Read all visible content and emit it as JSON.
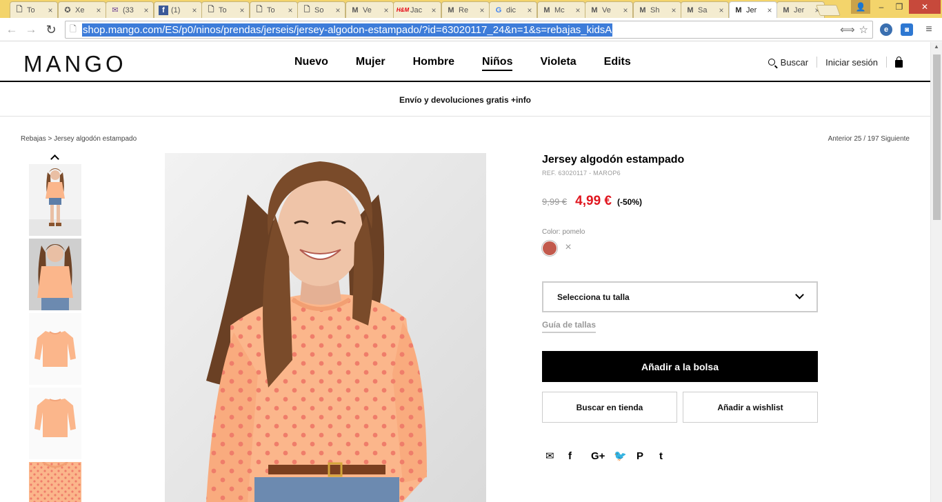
{
  "browser": {
    "tabs": [
      {
        "favicon": "document-icon",
        "glyph": "🗋",
        "title": "To"
      },
      {
        "favicon": "xe-icon",
        "glyph": "✪",
        "title": "Xe"
      },
      {
        "favicon": "mail-icon",
        "glyph": "✉",
        "title": "(33"
      },
      {
        "favicon": "facebook-icon",
        "glyph": "f",
        "title": "(1)"
      },
      {
        "favicon": "document-icon",
        "glyph": "🗋",
        "title": "To"
      },
      {
        "favicon": "document-icon",
        "glyph": "🗋",
        "title": "To"
      },
      {
        "favicon": "document-icon",
        "glyph": "🗋",
        "title": "So"
      },
      {
        "favicon": "mango-icon",
        "glyph": "M",
        "title": "Ve"
      },
      {
        "favicon": "hm-icon",
        "glyph": "H&M",
        "title": "Jac"
      },
      {
        "favicon": "mango-icon",
        "glyph": "M",
        "title": "Re"
      },
      {
        "favicon": "google-icon",
        "glyph": "G",
        "title": "dic"
      },
      {
        "favicon": "mango-icon",
        "glyph": "M",
        "title": "Mc"
      },
      {
        "favicon": "mango-icon",
        "glyph": "M",
        "title": "Ve"
      },
      {
        "favicon": "mango-icon",
        "glyph": "M",
        "title": "Sh"
      },
      {
        "favicon": "mango-icon",
        "glyph": "M",
        "title": "Sa"
      },
      {
        "favicon": "mango-icon",
        "glyph": "M",
        "title": "Jer",
        "active": true
      },
      {
        "favicon": "mango-icon",
        "glyph": "M",
        "title": "Jer"
      }
    ],
    "tab_close": "×",
    "url": "shop.mango.com/ES/p0/ninos/prendas/jerseis/jersey-algodon-estampado/?id=63020117_24&n=1&s=rebajas_kidsA",
    "window_controls": {
      "user": "👤",
      "minimize": "–",
      "maximize": "❐",
      "close": "✕"
    },
    "nav": {
      "back": "←",
      "forward": "→",
      "reload": "↻",
      "translate": "⟺",
      "star": "☆",
      "menu": "≡",
      "ext1": "e",
      "ext2": "◙"
    }
  },
  "site": {
    "logo": "MANGO",
    "nav": [
      "Nuevo",
      "Mujer",
      "Hombre",
      "Niños",
      "Violeta",
      "Edits"
    ],
    "active_nav": "Niños",
    "search_label": "Buscar",
    "login_label": "Iniciar sesión",
    "promo": "Envío y devoluciones gratis +info"
  },
  "breadcrumb": {
    "text": "Rebajas > Jersey algodón estampado",
    "pager": "Anterior 25 / 197 Siguiente"
  },
  "product": {
    "title": "Jersey algodón estampado",
    "ref": "REF. 63020117 - MAROP6",
    "old_price": "9,99 €",
    "new_price": "4,99 €",
    "discount": "(-50%)",
    "color_label": "Color: pomelo",
    "color_hex": "#c25a4d",
    "size_placeholder": "Selecciona tu talla",
    "size_guide": "Guía de tallas",
    "add_to_bag": "Añadir a la bolsa",
    "find_in_store": "Buscar en tienda",
    "add_to_wishlist": "Añadir a wishlist"
  },
  "share": [
    {
      "name": "mail-icon",
      "glyph": "✉"
    },
    {
      "name": "facebook-icon",
      "glyph": "f"
    },
    {
      "name": "googleplus-icon",
      "glyph": "G+"
    },
    {
      "name": "twitter-icon",
      "glyph": "🐦"
    },
    {
      "name": "pinterest-icon",
      "glyph": "P"
    },
    {
      "name": "tumblr-icon",
      "glyph": "t"
    }
  ],
  "colors": {
    "price_red": "#e0161f",
    "tabstrip": "#f3d46b",
    "url_highlight": "#3d7cd9",
    "knit_orange": "#fbb68b",
    "dot_coral": "#ef7d6a"
  }
}
